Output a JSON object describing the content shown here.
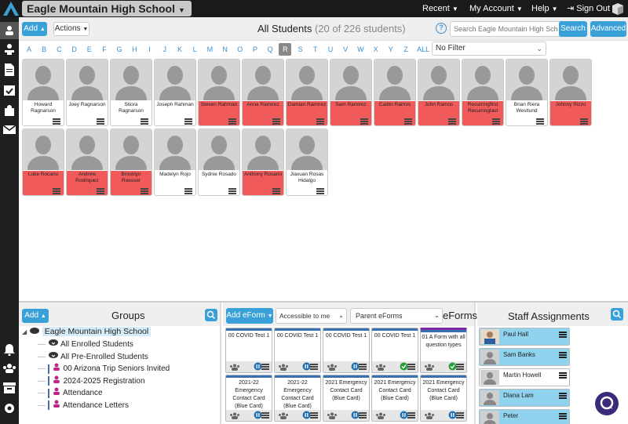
{
  "topbar": {
    "school_name": "Eagle Mountain High School",
    "recent": "Recent",
    "my_account": "My Account",
    "help": "Help",
    "sign_out": "Sign Out"
  },
  "toolbar": {
    "add_label": "Add",
    "actions_label": "Actions",
    "title": "All Students",
    "count_text": "(20 of 226 students)",
    "search_placeholder": "Search Eagle Mountain High Sch",
    "search_label": "Search",
    "advanced_label": "Advanced"
  },
  "alphabet": [
    "A",
    "B",
    "C",
    "D",
    "E",
    "F",
    "G",
    "H",
    "I",
    "J",
    "K",
    "L",
    "M",
    "N",
    "O",
    "P",
    "Q",
    "R",
    "S",
    "T",
    "U",
    "V",
    "W",
    "X",
    "Y",
    "Z",
    "ALL"
  ],
  "alphabet_selected": "R",
  "filter": {
    "value": "No Filter"
  },
  "students": [
    {
      "name": "Howard Ragnarson",
      "flag": false
    },
    {
      "name": "Joey Ragnarson",
      "flag": false
    },
    {
      "name": "Stiora Ragnarson",
      "flag": false
    },
    {
      "name": "Joseph Rahman",
      "flag": false
    },
    {
      "name": "Steven Rahman",
      "flag": true
    },
    {
      "name": "Anna Ramirez",
      "flag": true
    },
    {
      "name": "Damian Ramirez",
      "flag": true
    },
    {
      "name": "Sam Ramirez",
      "flag": true
    },
    {
      "name": "Caitlin Ramos",
      "flag": true
    },
    {
      "name": "John Ramos",
      "flag": true
    },
    {
      "name": "Recurringfirst Recurringlast",
      "flag": true
    },
    {
      "name": "Brian Riera Westlund",
      "flag": false
    },
    {
      "name": "Johnny Rizzo",
      "flag": true
    },
    {
      "name": "Luke Rocano",
      "flag": true
    },
    {
      "name": "Andrew Rodriquez",
      "flag": true
    },
    {
      "name": "Brooklyn Roesser",
      "flag": true
    },
    {
      "name": "Madelyn Rojo",
      "flag": false
    },
    {
      "name": "Sydnie Rosado",
      "flag": false
    },
    {
      "name": "Anthony Rosario",
      "flag": true
    },
    {
      "name": "Jiaxuan Rosas Hidalgo",
      "flag": false
    }
  ],
  "groups": {
    "add_label": "Add",
    "title": "Groups",
    "root": "Eagle Mountain High School",
    "items": [
      {
        "label": "All Enrolled Students",
        "icon": "cloud-download-icon"
      },
      {
        "label": "All Pre-Enrolled Students",
        "icon": "cloud-download-icon"
      },
      {
        "label": "00 Arizona Trip Seniors Invited",
        "icon": "users-icon"
      },
      {
        "label": "2024-2025 Registration",
        "icon": "users-icon"
      },
      {
        "label": "Attendance",
        "icon": "users-icon"
      },
      {
        "label": "Attendance Letters",
        "icon": "users-icon"
      }
    ]
  },
  "eforms": {
    "add_label": "Add eForm",
    "accessible_value": "Accessible to me",
    "type_value": "Parent eForms",
    "title": "eForms",
    "cards": [
      {
        "title": "00 COVID Test 1",
        "status": "pause"
      },
      {
        "title": "00 COVID Test 1",
        "status": "pause"
      },
      {
        "title": "00 COVID Test 1",
        "status": "pause"
      },
      {
        "title": "00 COVID Test 1",
        "status": "check"
      },
      {
        "title": "01 A Form with all question types",
        "status": "check"
      },
      {
        "title": "2021-22 Emergency Contact Card (Blue Card)",
        "status": "pause"
      },
      {
        "title": "2021-22 Emergency Contact Card (Blue Card)",
        "status": "pause"
      },
      {
        "title": "2021 Emergency Contact Card (Blue Card)",
        "status": "pause"
      },
      {
        "title": "2021 Emergency Contact Card (Blue Card)",
        "status": "pause"
      },
      {
        "title": "2021 Emergency Contact Card (Blue Card)",
        "status": "pause"
      }
    ]
  },
  "staff": {
    "title": "Staff Assignments",
    "people": [
      {
        "name": "Paul Hall",
        "has_photo": true,
        "highlight": true
      },
      {
        "name": "Sam Banks",
        "has_photo": false,
        "highlight": true
      },
      {
        "name": "Martin Howell",
        "has_photo": false,
        "highlight": false
      },
      {
        "name": "Diana Lam",
        "has_photo": false,
        "highlight": true
      },
      {
        "name": "Peter",
        "has_photo": false,
        "highlight": true
      }
    ]
  },
  "colors": {
    "accent": "#3aa0d8",
    "flag_red": "#f15a5a",
    "staff_blue": "#8fd3ee"
  }
}
